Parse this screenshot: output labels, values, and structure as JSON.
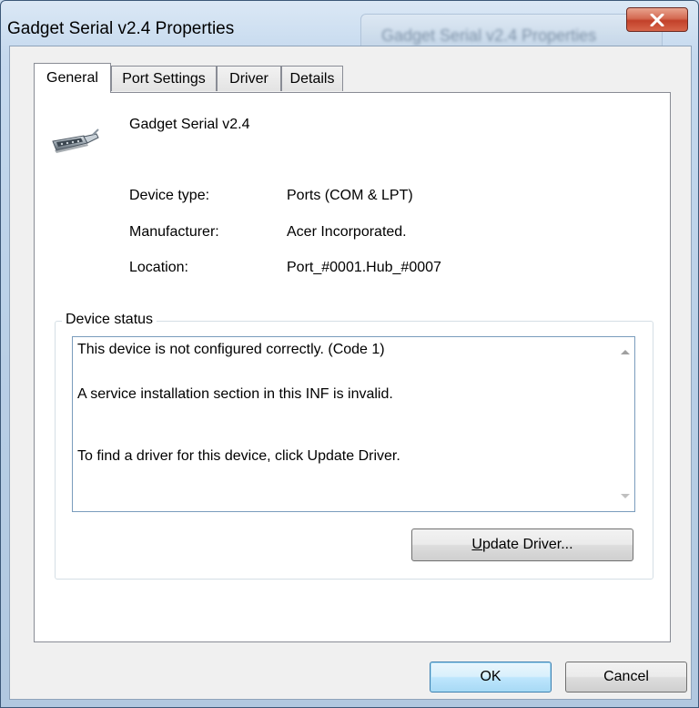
{
  "window": {
    "title": "Gadget Serial v2.4 Properties",
    "background_title": "Gadget Serial v2.4 Properties",
    "close_icon": "close-icon"
  },
  "tabs": [
    {
      "label": "General",
      "active": true
    },
    {
      "label": "Port Settings",
      "active": false
    },
    {
      "label": "Driver",
      "active": false
    },
    {
      "label": "Details",
      "active": false
    }
  ],
  "general": {
    "device_name": "Gadget Serial v2.4",
    "device_icon": "serial-port-icon",
    "properties": [
      {
        "label": "Device type:",
        "value": "Ports (COM & LPT)"
      },
      {
        "label": "Manufacturer:",
        "value": "Acer Incorporated."
      },
      {
        "label": "Location:",
        "value": "Port_#0001.Hub_#0007"
      }
    ],
    "status_group_label": "Device status",
    "status_lines": [
      "This device is not configured correctly. (Code 1)",
      "A service installation section in this INF is invalid.",
      "To find a driver for this device, click Update Driver."
    ],
    "update_driver": {
      "mnemonic": "U",
      "rest": "pdate Driver..."
    }
  },
  "footer": {
    "ok_label": "OK",
    "cancel_label": "Cancel"
  },
  "colors": {
    "close_button": "#c9452e",
    "default_button_border": "#3c7fb1"
  }
}
